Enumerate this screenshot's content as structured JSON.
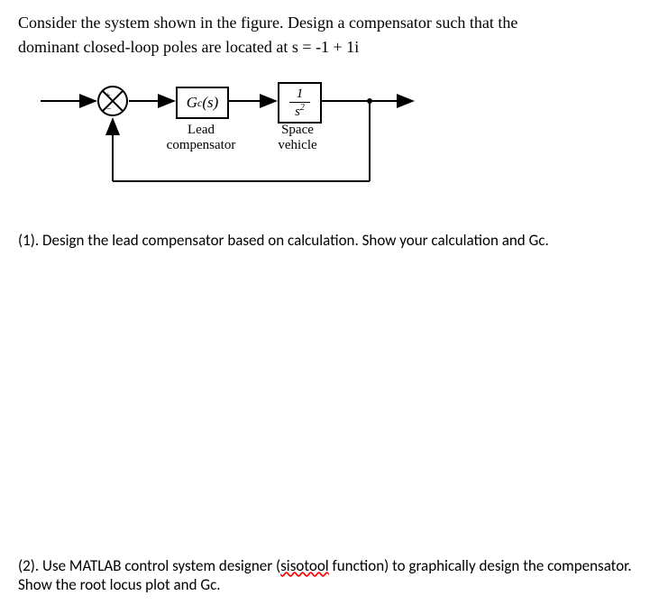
{
  "problem": {
    "line1": "Consider the system shown in the figure. Design a compensator such that the",
    "line2_prefix": "dominant closed-loop poles are located at ",
    "line2_eq": "s = -1 + 1i"
  },
  "diagram": {
    "gc_label_G": "G",
    "gc_label_sub": "c",
    "gc_label_s": "(s)",
    "plant_num": "1",
    "plant_den_s": "s",
    "plant_den_sup": "2",
    "lead_label_l1": "Lead",
    "lead_label_l2": "compensator",
    "space_label_l1": "Space",
    "space_label_l2": "vehicle",
    "plus": "+",
    "minus": "−"
  },
  "q1": {
    "text": "(1). Design the lead compensator based on calculation. Show your calculation and Gc."
  },
  "q2": {
    "prefix": "(2). Use MATLAB control system designer (",
    "tool": "sisotool",
    "suffix": " function) to graphically design the compensator. Show the root locus plot and Gc."
  }
}
